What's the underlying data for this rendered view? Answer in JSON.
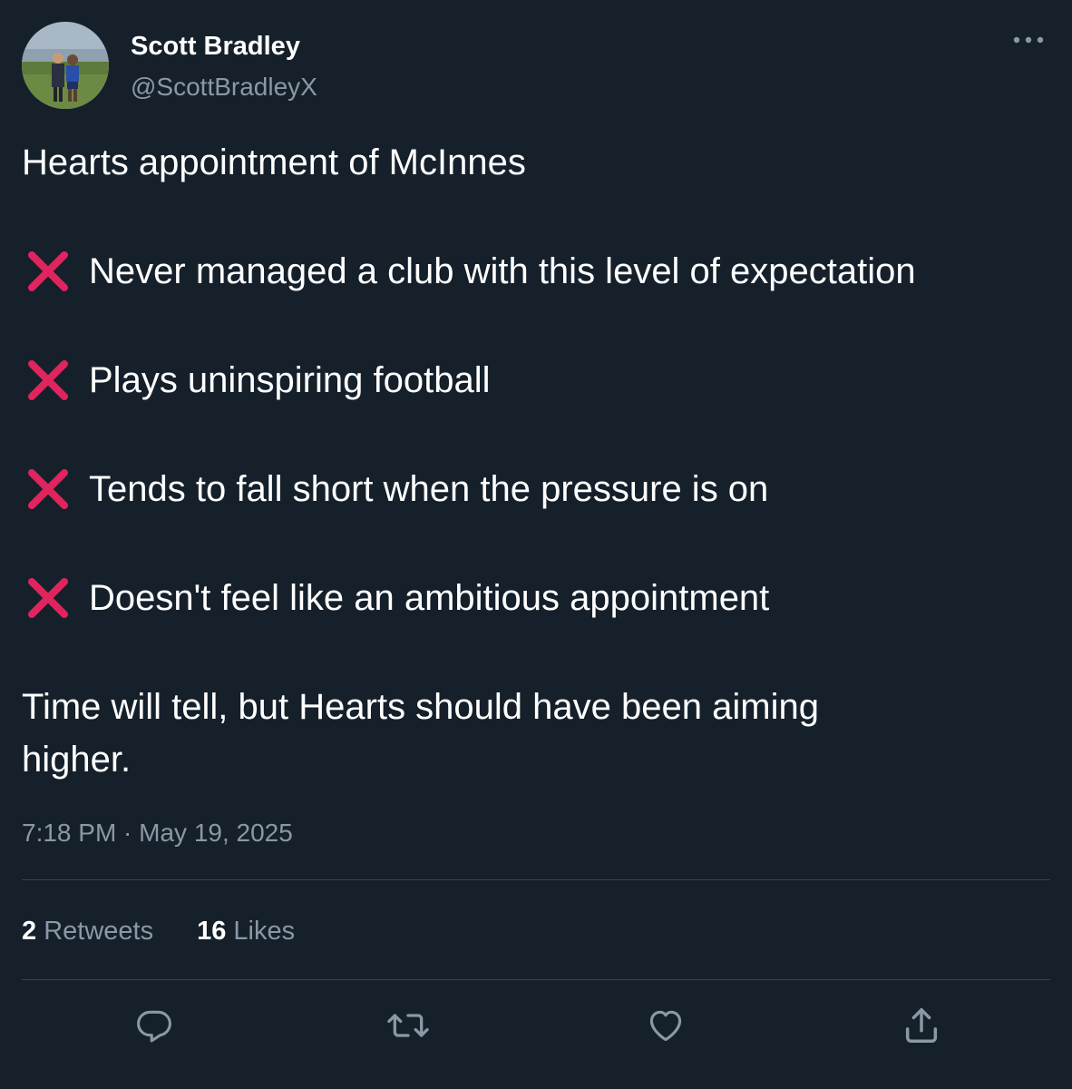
{
  "author": {
    "display_name": "Scott Bradley",
    "handle": "@ScottBradleyX"
  },
  "tweet": {
    "intro": "Hearts appointment of McInnes",
    "bullets": [
      "Never managed a club with this level of expectation",
      "Plays uninspiring football",
      "Tends to fall short when the pressure is on",
      "Doesn't feel like an ambitious appointment"
    ],
    "bullet_icon": "cross-mark-icon",
    "conclusion_line1": "Time will tell, but Hearts should have been aiming",
    "conclusion_line2": "higher.",
    "timestamp": "7:18 PM · May 19, 2025"
  },
  "stats": {
    "retweets_count": "2",
    "retweets_label": "Retweets",
    "likes_count": "16",
    "likes_label": "Likes"
  },
  "actions": [
    "reply-icon",
    "retweet-icon",
    "like-icon",
    "share-icon"
  ],
  "colors": {
    "background": "#15202b",
    "primary_text": "#ffffff",
    "secondary_text": "#8b98a5",
    "divider": "#38444d",
    "cross": "#e0245e"
  }
}
